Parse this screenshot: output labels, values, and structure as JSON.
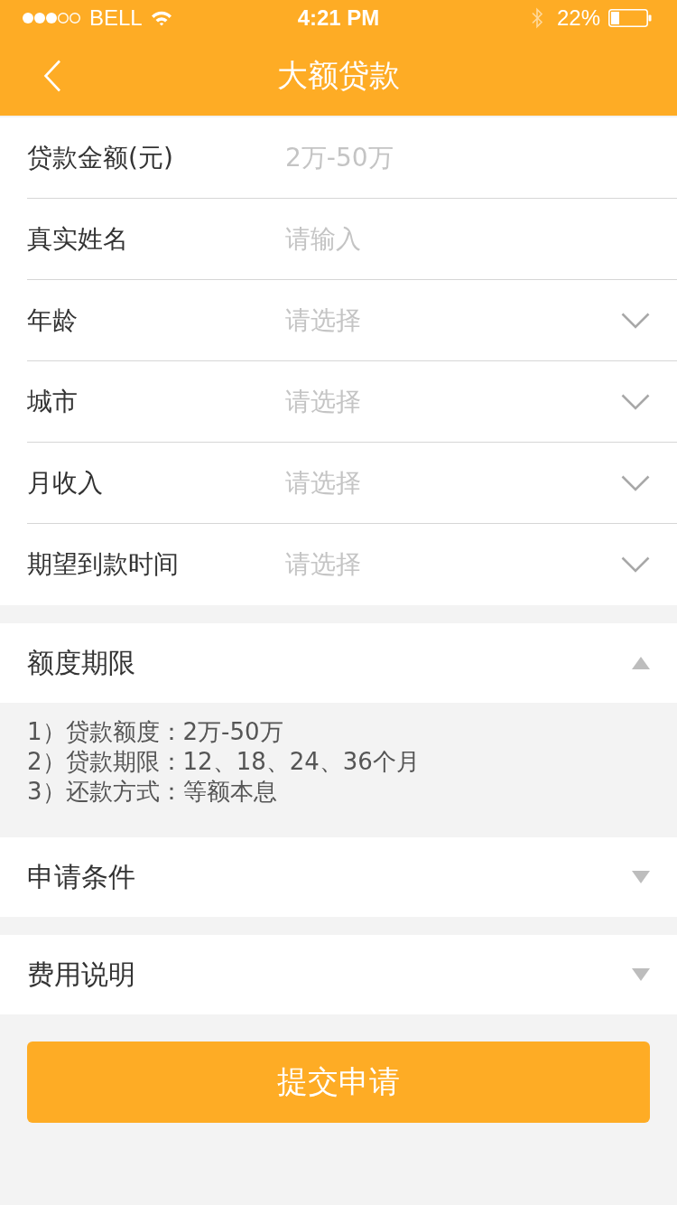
{
  "status_bar": {
    "carrier": "BELL",
    "time": "4:21 PM",
    "battery": "22%"
  },
  "nav_bar": {
    "title": "大额贷款"
  },
  "form": {
    "fields": [
      {
        "kind": "input",
        "label": "贷款金额(元)",
        "placeholder": "2万-50万"
      },
      {
        "kind": "input",
        "label": "真实姓名",
        "placeholder": "请输入"
      },
      {
        "kind": "select",
        "label": "年龄",
        "placeholder": "请选择"
      },
      {
        "kind": "select",
        "label": "城市",
        "placeholder": "请选择"
      },
      {
        "kind": "select",
        "label": "月收入",
        "placeholder": "请选择"
      },
      {
        "kind": "select",
        "label": "期望到款时间",
        "placeholder": "请选择"
      }
    ]
  },
  "sections": [
    {
      "title": "额度期限",
      "expanded": true,
      "lines": [
        "1）贷款额度：2万-50万",
        "2）贷款期限：12、18、24、36个月",
        "3）还款方式：等额本息"
      ]
    },
    {
      "title": "申请条件",
      "expanded": false
    },
    {
      "title": "费用说明",
      "expanded": false
    }
  ],
  "submit_button": "提交申请"
}
